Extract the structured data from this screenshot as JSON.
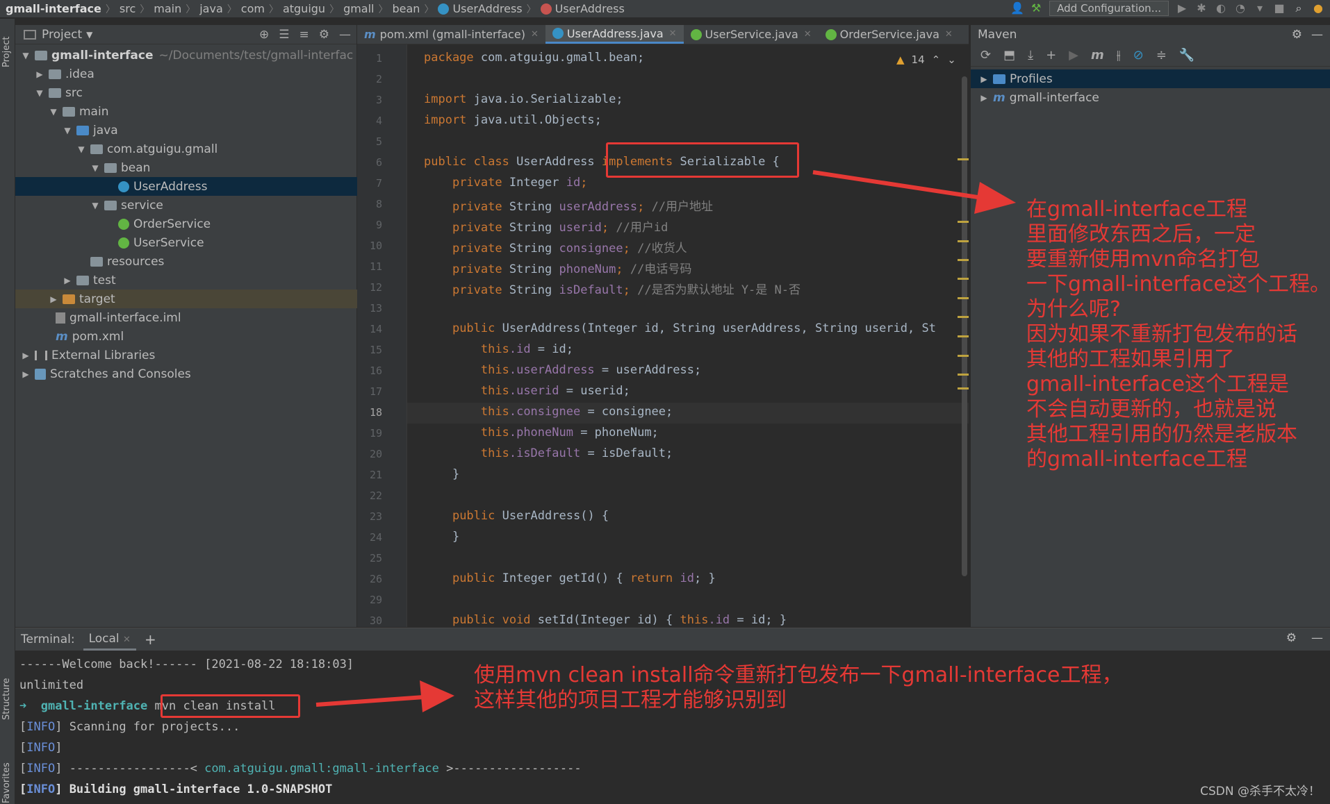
{
  "navbar": {
    "crumbs": [
      "gmall-interface",
      "src",
      "main",
      "java",
      "com",
      "atguigu",
      "gmall",
      "bean"
    ],
    "file_crumbs": [
      "UserAddress",
      "UserAddress"
    ],
    "add_config_label": "Add Configuration..."
  },
  "stripe": {
    "project_label": "Project",
    "structure_label": "Structure",
    "favorites_label": "Favorites"
  },
  "project_panel": {
    "title": "Project",
    "tree": [
      {
        "label": "gmall-interface",
        "extra": "~/Documents/test/gmall-interfac"
      },
      {
        "label": ".idea"
      },
      {
        "label": "src"
      },
      {
        "label": "main"
      },
      {
        "label": "java"
      },
      {
        "label": "com.atguigu.gmall"
      },
      {
        "label": "bean"
      },
      {
        "label": "UserAddress"
      },
      {
        "label": "service"
      },
      {
        "label": "OrderService"
      },
      {
        "label": "UserService"
      },
      {
        "label": "resources"
      },
      {
        "label": "test"
      },
      {
        "label": "target"
      },
      {
        "label": "gmall-interface.iml"
      },
      {
        "label": "pom.xml"
      },
      {
        "label": "External Libraries"
      },
      {
        "label": "Scratches and Consoles"
      }
    ]
  },
  "tabs": [
    {
      "label": "pom.xml (gmall-interface)"
    },
    {
      "label": "UserAddress.java"
    },
    {
      "label": "UserService.java"
    },
    {
      "label": "OrderService.java"
    }
  ],
  "editor": {
    "warning_count": "14",
    "line_numbers": [
      "1",
      "2",
      "3",
      "4",
      "5",
      "6",
      "7",
      "8",
      "9",
      "10",
      "11",
      "12",
      "13",
      "14",
      "15",
      "16",
      "17",
      "18",
      "19",
      "20",
      "21",
      "22",
      "23",
      "24",
      "25",
      "26",
      "29",
      "30"
    ],
    "current_line": "18",
    "lines": {
      "l1": {
        "kw": "package",
        "rest": " com.atguigu.gmall.bean;"
      },
      "l3": {
        "kw": "import",
        "rest": " java.io.Serializable;"
      },
      "l4": {
        "kw": "import",
        "rest": " java.util.Objects;"
      },
      "l6": {
        "kw": "public class",
        "name": " UserAddress ",
        "impl": "implements",
        "iface": " Serializable ",
        "brace": "{"
      },
      "l7": {
        "kw": "private",
        "type": " Integer ",
        "field": "id",
        "end": ";"
      },
      "l8": {
        "kw": "private",
        "type": " String ",
        "field": "userAddress",
        "end": ";",
        "comment": " //用户地址"
      },
      "l9": {
        "kw": "private",
        "type": " String ",
        "field": "userid",
        "end": ";",
        "comment": " //用户id"
      },
      "l10": {
        "kw": "private",
        "type": " String ",
        "field": "consignee",
        "end": ";",
        "comment": " //收货人"
      },
      "l11": {
        "kw": "private",
        "type": " String ",
        "field": "phoneNum",
        "end": ";",
        "comment": " //电话号码"
      },
      "l12": {
        "kw": "private",
        "type": " String ",
        "field": "isDefault",
        "end": ";",
        "comment": " //是否为默认地址 Y-是 N-否"
      },
      "l14": {
        "kw": "public",
        "name": " UserAddress",
        "rest": "(Integer id, String userAddress, String userid, St"
      },
      "l15": {
        "this": "this",
        "field": ".id",
        "rest": " = id;"
      },
      "l16": {
        "this": "this",
        "field": ".userAddress",
        "rest": " = userAddress;"
      },
      "l17": {
        "this": "this",
        "field": ".userid",
        "rest": " = userid;"
      },
      "l18": {
        "this": "this",
        "field": ".consignee",
        "rest": " = consignee;"
      },
      "l19": {
        "this": "this",
        "field": ".phoneNum",
        "rest": " = phoneNum;"
      },
      "l20": {
        "this": "this",
        "field": ".isDefault",
        "rest": " = isDefault;"
      },
      "l21": {
        "rest": "}"
      },
      "l23": {
        "kw": "public",
        "name": " UserAddress",
        "rest": "() {"
      },
      "l24": {
        "rest": "}"
      },
      "l26": {
        "kw": "public",
        "type": " Integer ",
        "name": "getId",
        "rest": "() { ",
        "ret": "return",
        "field": " id",
        "end": "; }"
      },
      "l30": {
        "kw": "public void",
        "name": " setId",
        "rest": "(Integer id) { ",
        "this": "this",
        "field": ".id",
        "end": " = id; }"
      }
    }
  },
  "annotation_right": [
    "在gmall-interface工程",
    "里面修改东西之后，一定",
    "要重新使用mvn命名打包",
    "一下gmall-interface这个工程。",
    "为什么呢?",
    "因为如果不重新打包发布的话",
    "其他的工程如果引用了",
    "gmall-interface这个工程是",
    "不会自动更新的，也就是说",
    "其他工程引用的仍然是老版本",
    "的gmall-interface工程"
  ],
  "maven": {
    "title": "Maven",
    "items": [
      {
        "label": "Profiles"
      },
      {
        "label": "gmall-interface"
      }
    ]
  },
  "terminal": {
    "title": "Terminal:",
    "tab": "Local",
    "welcome": "------Welcome back!------ [2021-08-22 18:18:03]",
    "unlimited": "unlimited",
    "prompt_dir": "gmall-interface",
    "command": "mvn clean install",
    "info_tag": "INFO",
    "line1": " Scanning for projects...",
    "line3_pre": " -----------------< ",
    "line3_mid": "com.atguigu.gmall:gmall-interface",
    "line3_post": " >------------------",
    "line4": " Building gmall-interface 1.0-SNAPSHOT"
  },
  "annotation_bottom": [
    "使用mvn clean install命令重新打包发布一下gmall-interface工程，",
    "这样其他的项目工程才能够识别到"
  ],
  "watermark": "CSDN @杀手不太冷！",
  "colors": {
    "annotation": "#e53935",
    "keyword": "#cc7832",
    "field": "#9876aa",
    "comment": "#808080",
    "selection": "#0d293e"
  }
}
